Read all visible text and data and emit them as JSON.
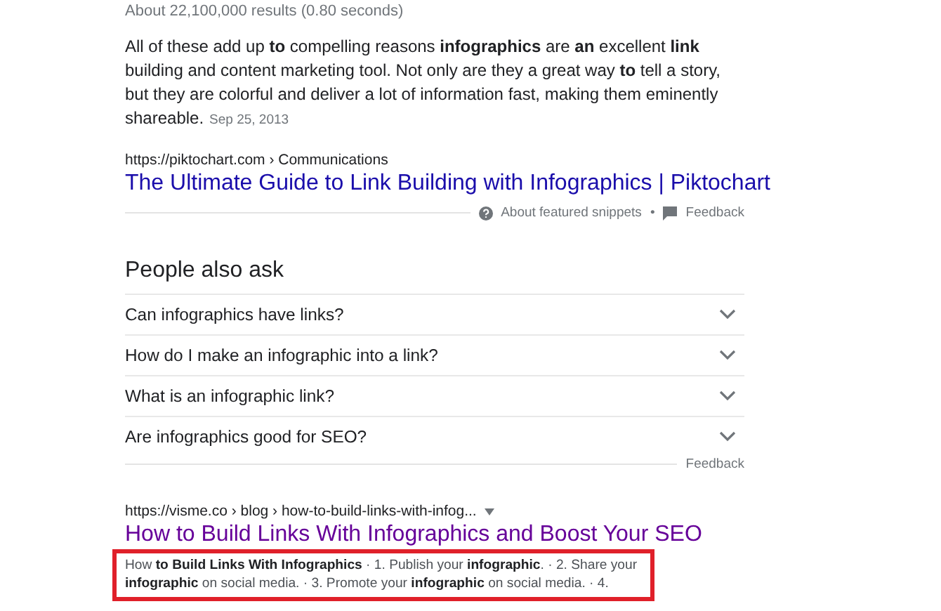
{
  "result_stats": "About 22,100,000 results (0.80 seconds)",
  "featured_snippet": {
    "text": "All of these add up **to** compelling reasons **infographics** are **an** excellent **link** building and content marketing tool. Not only are they a great way **to** tell a story, but they are colorful and deliver a lot of information fast, making them eminently shareable.",
    "date": "Sep 25, 2013",
    "url": "https://piktochart.com › Communications",
    "title": "The Ultimate Guide to Link Building with Infographics | Piktochart",
    "about": "About featured snippets",
    "separator": "•",
    "feedback": "Feedback"
  },
  "people_also_ask": {
    "heading": "People also ask",
    "questions": [
      {
        "text": "Can infographics have links?",
        "expanded": false
      },
      {
        "text": "How do I make an infographic into a link?",
        "expanded": false
      },
      {
        "text": "What is an infographic link?",
        "expanded": false
      },
      {
        "text": "Are infographics good for SEO?",
        "expanded": false
      }
    ],
    "feedback": "Feedback"
  },
  "result": {
    "url": "https://visme.co › blog › how-to-build-links-with-infog...",
    "title": "How to Build Links With Infographics and Boost Your SEO",
    "snippet": "How **to Build Links With Infographics** · 1. Publish your **infographic**. · 2. Share your **infographic** on social media. · 3. Promote your **infographic** on social media. · 4.",
    "highlighted": true
  }
}
